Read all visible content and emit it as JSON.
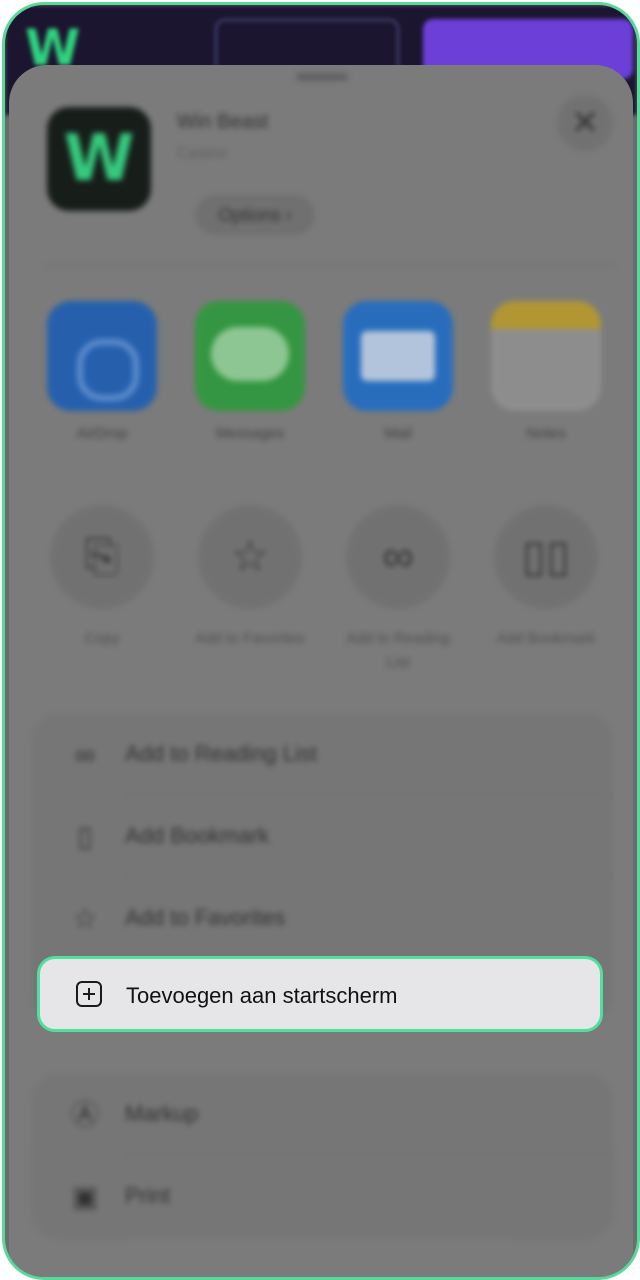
{
  "header": {
    "app_title": "Win Beast",
    "app_subtitle": "Casino",
    "options_label": "Options",
    "logo_letter": "W",
    "close_symbol": "✕"
  },
  "share_targets": [
    {
      "label": "AirDrop",
      "icon": "airdrop-icon"
    },
    {
      "label": "Messages",
      "icon": "messages-icon"
    },
    {
      "label": "Mail",
      "icon": "mail-icon"
    },
    {
      "label": "Notes",
      "icon": "notes-icon"
    }
  ],
  "actions": [
    {
      "label": "Copy",
      "icon": "copy-icon",
      "glyph": "⎘"
    },
    {
      "label": "Add to Favorites",
      "icon": "star-icon",
      "glyph": "☆"
    },
    {
      "label": "Add to Reading List",
      "icon": "glasses-icon",
      "glyph": "∞"
    },
    {
      "label": "Add Bookmark",
      "icon": "book-icon",
      "glyph": "▯▯"
    }
  ],
  "menu_group1": [
    {
      "label": "Add to Reading List",
      "icon": "glasses-icon",
      "glyph": "∞"
    },
    {
      "label": "Add Bookmark",
      "icon": "book-icon",
      "glyph": "▯"
    },
    {
      "label": "Add to Favorites",
      "icon": "star-icon",
      "glyph": "☆"
    }
  ],
  "highlighted_action": {
    "label": "Toevoegen aan startscherm",
    "icon": "plus-square-icon"
  },
  "menu_group2": [
    {
      "label": "Markup",
      "icon": "markup-icon",
      "glyph": "Ⓐ"
    },
    {
      "label": "Print",
      "icon": "print-icon",
      "glyph": "▣"
    }
  ],
  "colors": {
    "highlight_border": "#4fe09e",
    "frame_border": "#57d99a",
    "brand_green": "#2fd27e",
    "purple_button": "#6c3fd8"
  }
}
